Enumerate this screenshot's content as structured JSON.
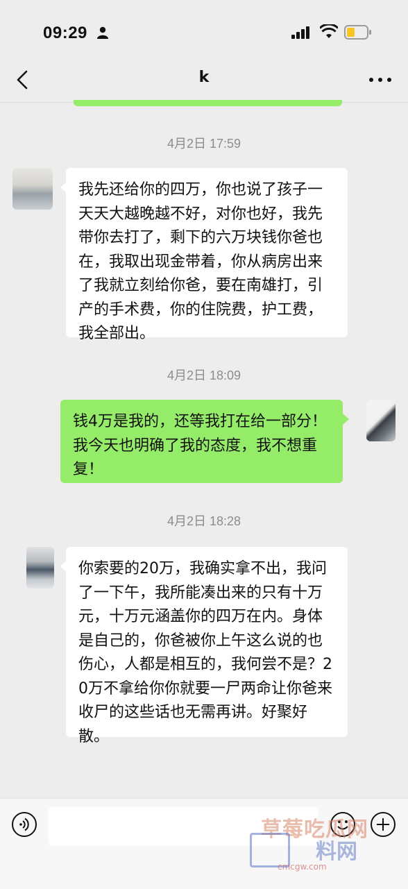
{
  "status_bar": {
    "time": "09:29"
  },
  "nav": {
    "title": "k"
  },
  "messages": [
    {
      "timestamp": "4月2日 17:59"
    },
    {
      "side": "in",
      "text": "我先还给你的四万，你也说了孩子一天天大越晚越不好，对你也好，我先带你去打了，剩下的六万块钱你爸也在，我取出现金带着，你从病房出来了我就立刻给你爸，要在南雄打，引产的手术费，你的住院费，护工费，我全部出。"
    },
    {
      "timestamp": "4月2日 18:09"
    },
    {
      "side": "out",
      "text": "钱4万是我的，还等我打在给一部分！我今天也明确了我的态度，我不想重复！"
    },
    {
      "timestamp": "4月2日 18:28"
    },
    {
      "side": "in",
      "text": "你索要的20万，我确实拿不出，我问了一下午，我所能凑出来的只有十万元，十万元涵盖你的四万在内。身体是自己的，你爸被你上午这么说的也伤心，人都是相互的，我何尝不是？20万不拿给你你就要一尸两命让你爸来收尸的这些话也无需再讲。好聚好散。"
    }
  ],
  "watermark": {
    "text_a": "草莓吃瓜网",
    "text_b": "料网",
    "url": "cmcgw.com"
  }
}
